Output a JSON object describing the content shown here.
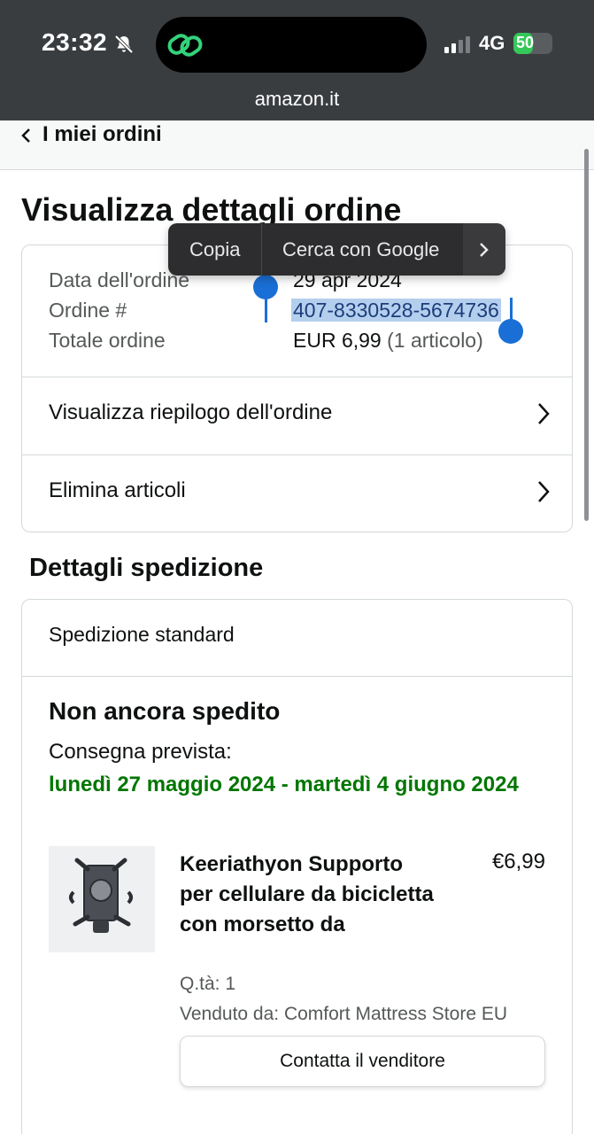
{
  "status_bar": {
    "time": "23:32",
    "network": "4G",
    "battery": "50",
    "battery_level": 0.5,
    "url": "amazon.it"
  },
  "nav": {
    "back_label": "I miei ordini"
  },
  "page_title": "Visualizza dettagli ordine",
  "order_summary": {
    "date_label": "Data dell'ordine",
    "date_value": "29 apr 2024",
    "order_label": "Ordine #",
    "order_number": "407-8330528-5674736",
    "total_label": "Totale ordine",
    "total_value": "EUR 6,99",
    "total_items": "(1 articolo)"
  },
  "links": {
    "view_summary": "Visualizza riepilogo dell'ordine",
    "delete_items": "Elimina articoli"
  },
  "context_menu": {
    "copy": "Copia",
    "search_google": "Cerca con Google"
  },
  "shipping": {
    "section_title": "Dettagli spedizione",
    "type": "Spedizione standard",
    "status": "Non ancora spedito",
    "delivery_label": "Consegna prevista:",
    "delivery_dates": "lunedì 27 maggio 2024 - martedì 4 giugno 2024"
  },
  "item": {
    "title": "Keeriathyon Supporto per cellulare da bicicletta con morsetto da",
    "price": "€6,99",
    "quantity": "Q.tà: 1",
    "seller": "Venduto da: Comfort Mattress Store EU",
    "contact_button": "Contatta il venditore"
  },
  "colors": {
    "delivery_green": "#007600",
    "selection": "#b4cfee",
    "handle_blue": "#1a6fd6"
  }
}
